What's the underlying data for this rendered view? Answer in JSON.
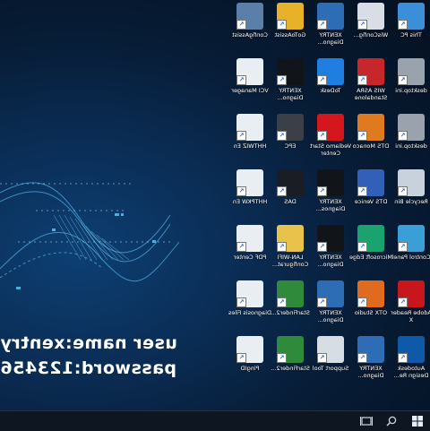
{
  "desktop": {
    "credentials": {
      "user_line": "user name:xentry",
      "pass_line": "password:123456"
    },
    "icons": [
      {
        "label": "This PC",
        "icon": "computer-icon",
        "color": "#3b8fd8"
      },
      {
        "label": "WisConfig...",
        "icon": "car-lock-icon",
        "color": "#d9dee6"
      },
      {
        "label": "XENTRY Diagno...",
        "icon": "xentry-sim-icon",
        "color": "#2d6db5"
      },
      {
        "label": "GoToAssist",
        "icon": "helmet-icon",
        "color": "#e8b12a"
      },
      {
        "label": "ConfigAssist",
        "icon": "gears-icon",
        "color": "#5a7fa8"
      },
      {
        "label": "desktop.ini",
        "icon": "ini-file-icon",
        "color": "#9aa3ad"
      },
      {
        "label": "WIS ASRA Standalone",
        "icon": "red-car-icon",
        "color": "#c7262b"
      },
      {
        "label": "ToDesk",
        "icon": "todesk-icon",
        "color": "#1f7fe0"
      },
      {
        "label": "XENTRY Diagno...",
        "icon": "xentry-truck-icon",
        "color": "#111418"
      },
      {
        "label": "VCI Manager",
        "icon": "vci-device-icon",
        "color": "#e9eef3"
      },
      {
        "label": "desktop.ini",
        "icon": "ini-file-icon",
        "color": "#9aa3ad"
      },
      {
        "label": "DTS Monaco",
        "icon": "monaco-m-icon",
        "color": "#e07a1e"
      },
      {
        "label": "Vediamo Start Center",
        "icon": "vediamo-v-icon",
        "color": "#d4171c"
      },
      {
        "label": "EPC",
        "icon": "epc-icon",
        "color": "#3a3f48"
      },
      {
        "label": "HHTWIZ En",
        "icon": "hht-device-icon",
        "color": "#e9eef3"
      },
      {
        "label": "Recycle Bin",
        "icon": "recycle-bin-icon",
        "color": "#c8d2dc"
      },
      {
        "label": "DTS Venice",
        "icon": "venice-v-icon",
        "color": "#3260b8"
      },
      {
        "label": "XENTRY Diagnos...",
        "icon": "xentry-kmt-icon",
        "color": "#111418"
      },
      {
        "label": "DAS",
        "icon": "mercedes-star-icon",
        "color": "#1a1e24"
      },
      {
        "label": "HHTPKW En",
        "icon": "hht-device-icon",
        "color": "#e9eef3"
      },
      {
        "label": "Control Panel",
        "icon": "control-panel-icon",
        "color": "#3a9fd6"
      },
      {
        "label": "Microsoft Edge",
        "icon": "edge-icon",
        "color": "#1aa36f"
      },
      {
        "label": "XENTRY Diagno...",
        "icon": "xentry-sim-icon",
        "color": "#111418"
      },
      {
        "label": "LAN-WIFI Configurat...",
        "icon": "wifi-folder-icon",
        "color": "#e8c24a"
      },
      {
        "label": "PDF Center",
        "icon": "pdf-center-icon",
        "color": "#e9eef3"
      },
      {
        "label": "Adobe Reader X",
        "icon": "adobe-reader-icon",
        "color": "#c8161d"
      },
      {
        "label": "OTX Studio",
        "icon": "otx-studio-icon",
        "color": "#e06a1e"
      },
      {
        "label": "XENTRY Diagno...",
        "icon": "xentry-cars-icon",
        "color": "#2d6db5"
      },
      {
        "label": "StarFinder2...",
        "icon": "starfinder-icon",
        "color": "#2f8a3c"
      },
      {
        "label": "Diagnosis Files",
        "icon": "document-icon",
        "color": "#e9eef3"
      },
      {
        "label": "Autodesk Design Re...",
        "icon": "autodesk-icon",
        "color": "#0f5aa8"
      },
      {
        "label": "XENTRY Diagno...",
        "icon": "xentry-kmt-icon",
        "color": "#2d6db5"
      },
      {
        "label": "Support Tool",
        "icon": "support-tool-icon",
        "color": "#d7dde4"
      },
      {
        "label": "StarFinder2...",
        "icon": "starfinder-icon",
        "color": "#2f8a3c"
      },
      {
        "label": "PingID",
        "icon": "pingid-icon",
        "color": "#e9eef3"
      }
    ]
  },
  "taskbar": {
    "task_view_icon": "task-view-icon",
    "search_icon": "search-icon",
    "start_icon": "windows-logo-icon"
  }
}
